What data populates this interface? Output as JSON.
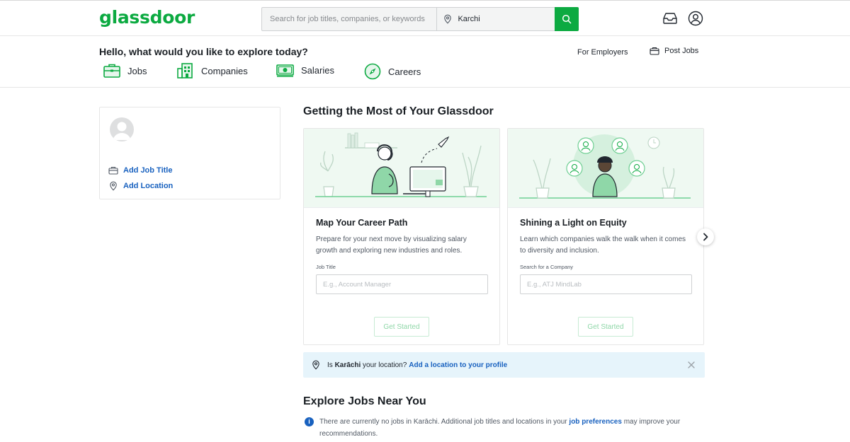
{
  "header": {
    "logo": "glassdoor",
    "search_placeholder": "Search for job titles, companies, or keywords",
    "location_value": "Karchi"
  },
  "subnav": {
    "greeting": "Hello, what would you like to explore today?",
    "for_employers": "For Employers",
    "post_jobs": "Post Jobs",
    "items": [
      {
        "label": "Jobs",
        "icon": "briefcase-icon"
      },
      {
        "label": "Companies",
        "icon": "building-icon"
      },
      {
        "label": "Salaries",
        "icon": "money-icon"
      },
      {
        "label": "Careers",
        "icon": "compass-icon"
      }
    ]
  },
  "profile": {
    "add_job_title": "Add Job Title",
    "add_location": "Add Location"
  },
  "main": {
    "section_title": "Getting the Most of Your Glassdoor",
    "cards": [
      {
        "title": "Map Your Career Path",
        "description": "Prepare for your next move by visualizing salary growth and exploring new industries and roles.",
        "field_label": "Job Title",
        "placeholder": "E.g., Account Manager",
        "button": "Get Started"
      },
      {
        "title": "Shining a Light on Equity",
        "description": "Learn which companies walk the walk when it comes to diversity and inclusion.",
        "field_label": "Search for a Company",
        "placeholder": "E.g., ATJ MindLab",
        "button": "Get Started"
      }
    ]
  },
  "location_banner": {
    "prefix": "Is",
    "city": "Karāchi",
    "middle": "your location?",
    "link": "Add a location to your profile"
  },
  "explore": {
    "title": "Explore Jobs Near You",
    "message_start": "There are currently no jobs in Karāchi. Additional job titles and locations in your",
    "link": "job preferences",
    "message_end": "may improve your recommendations."
  },
  "colors": {
    "brand_green": "#0caa41",
    "link_blue": "#1861bf",
    "banner_bg": "#e6f4fb",
    "illustration_bg": "#eff9f2"
  }
}
